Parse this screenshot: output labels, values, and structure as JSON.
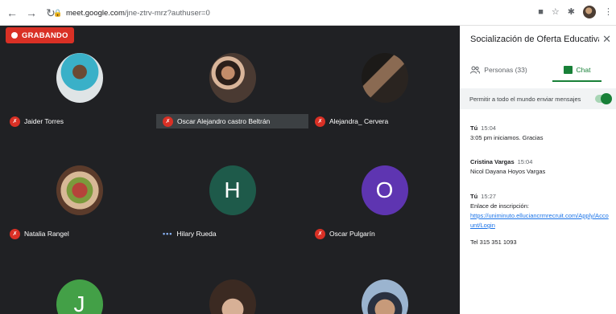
{
  "browser": {
    "url_host": "meet.google.com",
    "url_path": "/jne-ztrv-mrz?authuser=0"
  },
  "recording": {
    "label": "GRABANDO",
    "color": "#d93025"
  },
  "participants": [
    {
      "name": "Jaider Torres",
      "avatar": "photo",
      "muted": true
    },
    {
      "name": "Oscar Alejandro castro Beltrán",
      "avatar": "photo",
      "muted": true,
      "active": true
    },
    {
      "name": "Alejandra_ Cervera",
      "avatar": "photo",
      "muted": true
    },
    {
      "name": "Natalia Rangel",
      "avatar": "photo",
      "muted": true
    },
    {
      "name": "Hilary Rueda",
      "avatar": "H",
      "avatar_color": "#1e5a4a",
      "muted": false,
      "speaking": true
    },
    {
      "name": "Oscar Pulgarín",
      "avatar": "O",
      "avatar_color": "#5e35b1",
      "muted": true
    },
    {
      "name": "",
      "avatar": "J",
      "avatar_color": "#43a047"
    },
    {
      "name": "",
      "avatar": "photo"
    },
    {
      "name": "",
      "avatar": "photo"
    }
  ],
  "panel": {
    "title": "Socialización de Oferta Educativa...",
    "tabs": {
      "people": "Personas (33)",
      "chat": "Chat"
    },
    "allow_label": "Permitir a todo el mundo enviar mensajes",
    "allow_enabled": true,
    "messages": [
      {
        "sender": "Tú",
        "time": "15:04",
        "text": "3:05 pm iniciamos. Gracias"
      },
      {
        "sender": "Cristina Vargas",
        "time": "15:04",
        "text": "Nicol Dayana Hoyos Vargas"
      },
      {
        "sender": "Tú",
        "time": "15:27",
        "text": "Enlace de inscripción:",
        "link": "https://uniminuto.elluciancrmrecruit.com/Apply/Account/Login"
      },
      {
        "sender": "",
        "time": "",
        "text": "Tel 315 351 1093"
      }
    ]
  }
}
